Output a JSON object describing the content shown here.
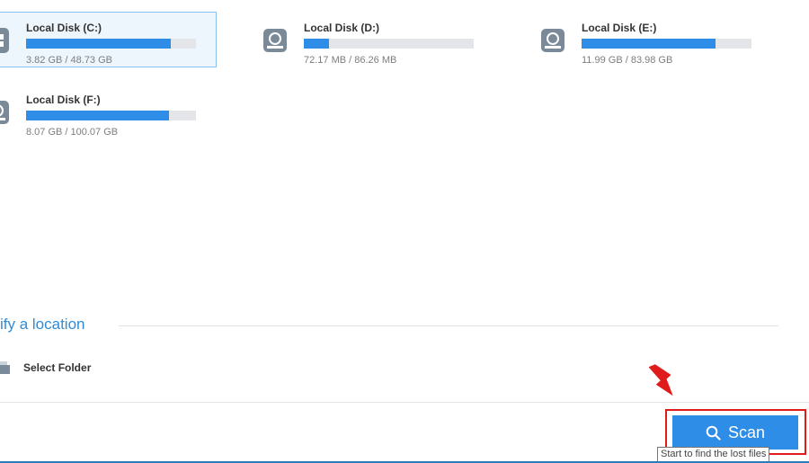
{
  "disks": [
    {
      "name": "Local Disk (C:)",
      "size": "3.82 GB / 48.73 GB",
      "usage": 0.85,
      "selected": true,
      "icon": "windows-drive-icon"
    },
    {
      "name": "Local Disk (D:)",
      "size": "72.17 MB / 86.26 MB",
      "usage": 0.15,
      "selected": false,
      "icon": "hard-disk-icon"
    },
    {
      "name": "Local Disk (E:)",
      "size": "11.99 GB / 83.98 GB",
      "usage": 0.79,
      "selected": false,
      "icon": "hard-disk-icon"
    },
    {
      "name": "Local Disk (F:)",
      "size": "8.07 GB / 100.07 GB",
      "usage": 0.84,
      "selected": false,
      "icon": "hard-disk-icon"
    }
  ],
  "location": {
    "section_title": "ify a location",
    "select_folder_label": "Select Folder"
  },
  "scan": {
    "label": "Scan",
    "tooltip": "Start to find the lost files"
  },
  "colors": {
    "accent": "#2e8de6",
    "highlight": "#e01b1b",
    "section_title": "#2f8bd8"
  }
}
